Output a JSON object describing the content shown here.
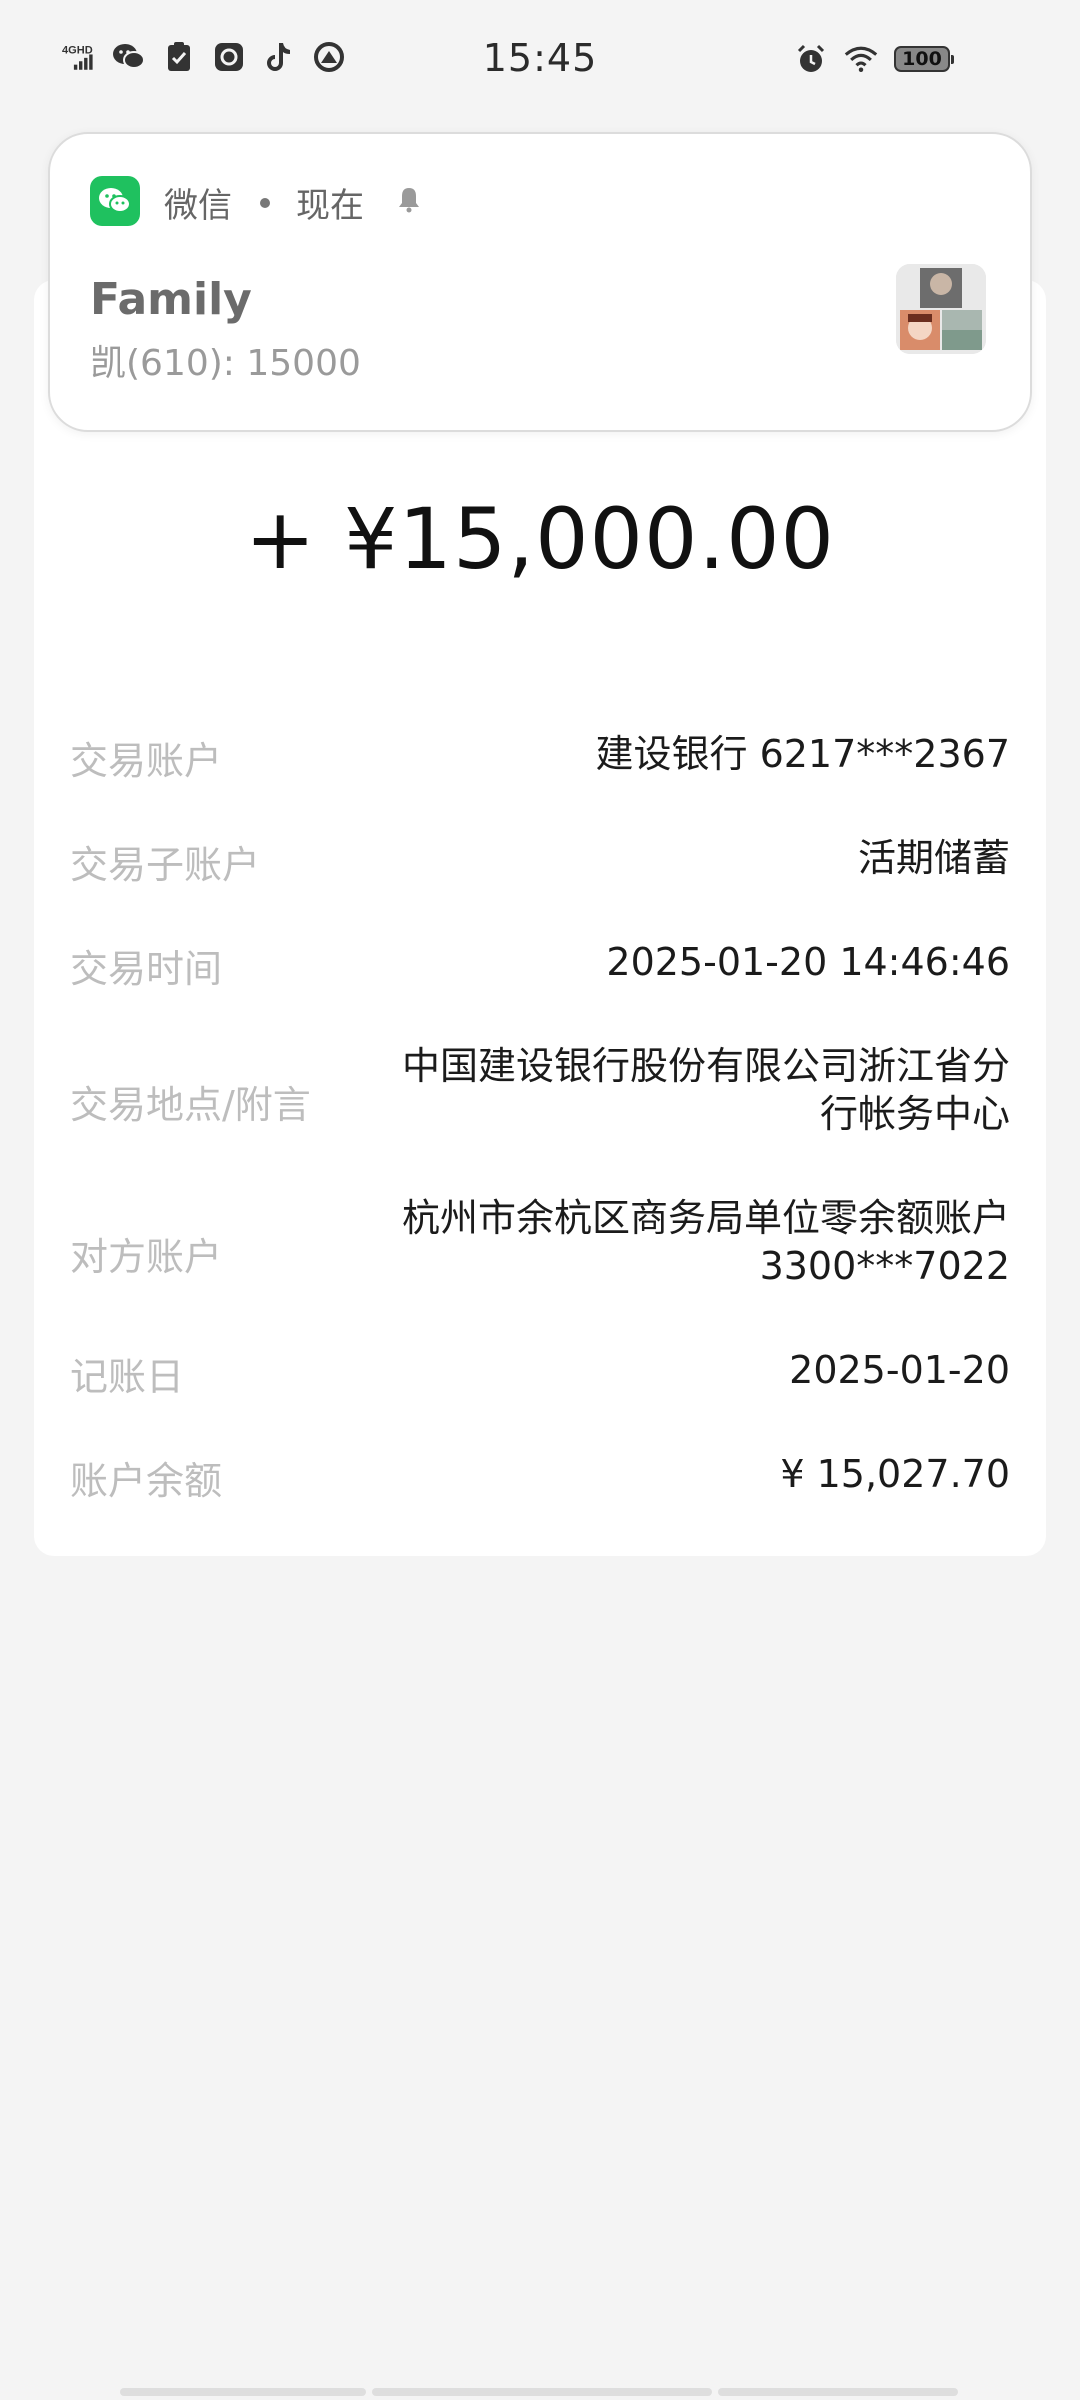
{
  "status_bar": {
    "time": "15:45",
    "network": "4GHD",
    "battery": "100",
    "left_icons": [
      "signal-icon",
      "wechat-icon",
      "clipboard-check-icon",
      "at-mail-icon",
      "tiktok-icon",
      "assistant-icon"
    ],
    "right_icons": [
      "alarm-icon",
      "wifi-icon",
      "battery-icon"
    ]
  },
  "notification": {
    "app": "微信",
    "time": "现在",
    "title": "Family",
    "text": "凯(610): 15000",
    "app_color": "#1fc15f"
  },
  "transaction": {
    "amount": "+ ¥15,000.00",
    "rows": [
      {
        "label": "交易账户",
        "value": "建设银行 6217***2367"
      },
      {
        "label": "交易子账户",
        "value": "活期储蓄"
      },
      {
        "label": "交易时间",
        "value": "2025-01-20 14:46:46"
      },
      {
        "label": "交易地点/附言",
        "value_lines": [
          "中国建设银行股份有限公司浙江省分",
          "行帐务中心"
        ]
      },
      {
        "label": "对方账户",
        "value_lines": [
          "杭州市余杭区商务局单位零余额账户",
          "3300***7022"
        ]
      },
      {
        "label": "记账日",
        "value": "2025-01-20"
      },
      {
        "label": "账户余额",
        "value": "¥ 15,027.70"
      }
    ]
  }
}
